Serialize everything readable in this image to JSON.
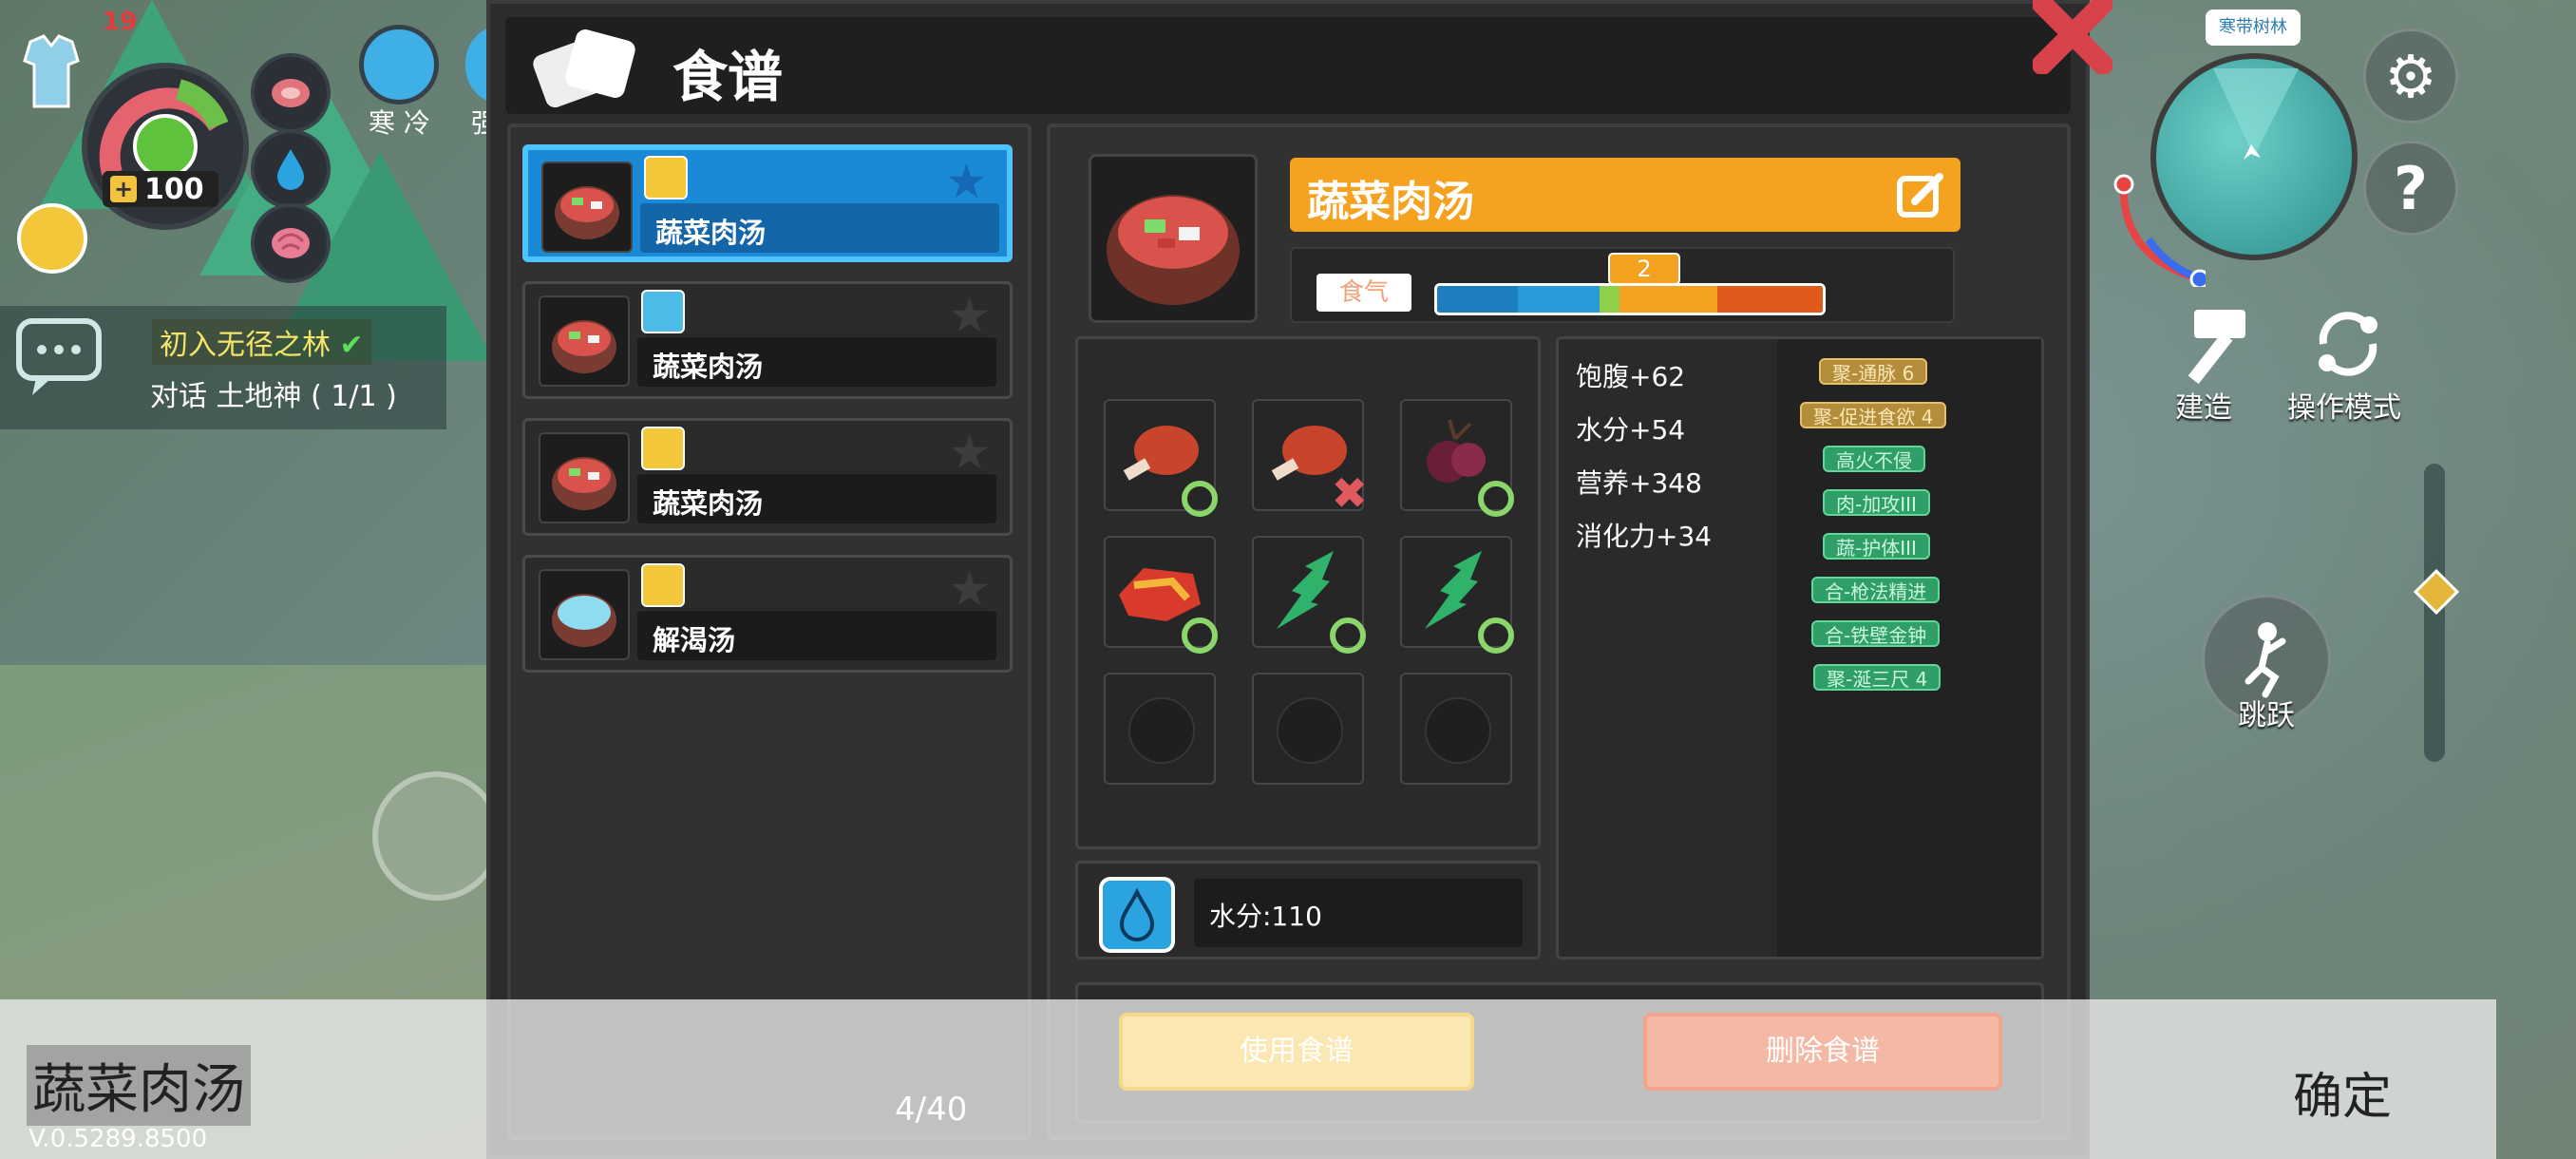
{
  "header": {
    "title": "食谱"
  },
  "hud_left": {
    "hp_value": "100",
    "top_number": "19",
    "cold_label": "寒 冷",
    "second_label_partial": "强",
    "quest_title": "初入无径之林",
    "quest_task": "对话 土地神 ( 1/1 )"
  },
  "recipes": {
    "items": [
      {
        "name": "蔬菜肉汤",
        "badge_color": "#f4c63a",
        "selected": true
      },
      {
        "name": "蔬菜肉汤",
        "badge_color": "#4cbbe8",
        "selected": false
      },
      {
        "name": "蔬菜肉汤",
        "badge_color": "#f4c63a",
        "selected": false
      },
      {
        "name": "解渴汤",
        "badge_color": "#f4c63a",
        "selected": false
      }
    ],
    "page_count": "4/40"
  },
  "detail": {
    "name": "蔬菜肉汤",
    "meter_label": "食气",
    "meter_value": "2",
    "meter_fraction": 0.275,
    "ingredients": [
      {
        "icon": "drumstick-icon",
        "status": "ok"
      },
      {
        "icon": "drumstick-icon",
        "status": "missing"
      },
      {
        "icon": "berry-icon",
        "status": "ok"
      },
      {
        "icon": "raw-meat-icon",
        "status": "ok"
      },
      {
        "icon": "herb-leaf-icon",
        "status": "ok"
      },
      {
        "icon": "herb-leaf-icon",
        "status": "ok"
      },
      {
        "icon": "",
        "status": "empty"
      },
      {
        "icon": "",
        "status": "empty"
      },
      {
        "icon": "",
        "status": "empty"
      }
    ],
    "water_label": "水分:110",
    "stats": [
      "饱腹+62",
      "水分+54",
      "营养+348",
      "消化力+34"
    ],
    "tags": [
      {
        "text": "聚-通脉 6",
        "kind": "gold"
      },
      {
        "text": "聚-促进食欲 4",
        "kind": "gold"
      },
      {
        "text": "高火不侵",
        "kind": "green"
      },
      {
        "text": "肉-加攻III",
        "kind": "green"
      },
      {
        "text": "蔬-护体III",
        "kind": "green"
      },
      {
        "text": "合-枪法精进",
        "kind": "green"
      },
      {
        "text": "合-铁壁金钟",
        "kind": "green"
      },
      {
        "text": "聚-涎三尺 4",
        "kind": "green"
      }
    ]
  },
  "actions": {
    "use": "使用食谱",
    "delete": "删除食谱",
    "confirm": "确定"
  },
  "bottom": {
    "name": "蔬菜肉汤",
    "version": "V.0.5289.8500"
  },
  "hud_right": {
    "map_label": "寒带树林",
    "build": "建造",
    "mode": "操作模式",
    "jump": "跳跃"
  },
  "colors": {
    "accent": "#1b8ad6",
    "banner": "#f4a21f",
    "ok": "#8ad66a",
    "bad": "#e0595e"
  }
}
